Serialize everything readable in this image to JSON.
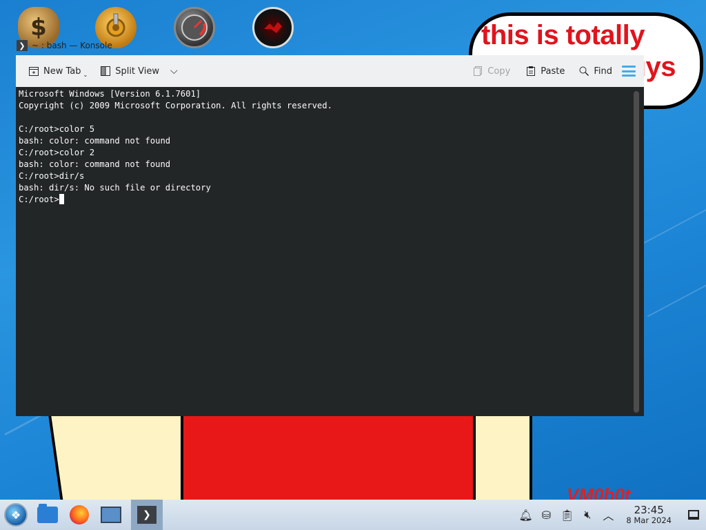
{
  "desktop": {
    "bubble_line1": "this is totally",
    "bubble_line2": "uys",
    "watermark": "VM0b0t",
    "icons": [
      "money-bag-icon",
      "gear-icon",
      "speedometer-icon",
      "red-disc-icon"
    ]
  },
  "window": {
    "title": "~ : bash — Konsole",
    "toolbar": {
      "new_tab": "New Tab",
      "split_view": "Split View",
      "copy": "Copy",
      "paste": "Paste",
      "find": "Find"
    },
    "terminal_lines": [
      "Microsoft Windows [Version 6.1.7601]",
      "Copyright (c) 2009 Microsoft Corporation. All rights reserved.",
      "",
      "C:/root>color 5",
      "bash: color: command not found",
      "C:/root>color 2",
      "bash: color: command not found",
      "C:/root>dir/s",
      "bash: dir/s: No such file or directory"
    ],
    "prompt": "C:/root>"
  },
  "taskbar": {
    "time": "23:45",
    "date": "8 Mar 2024"
  }
}
